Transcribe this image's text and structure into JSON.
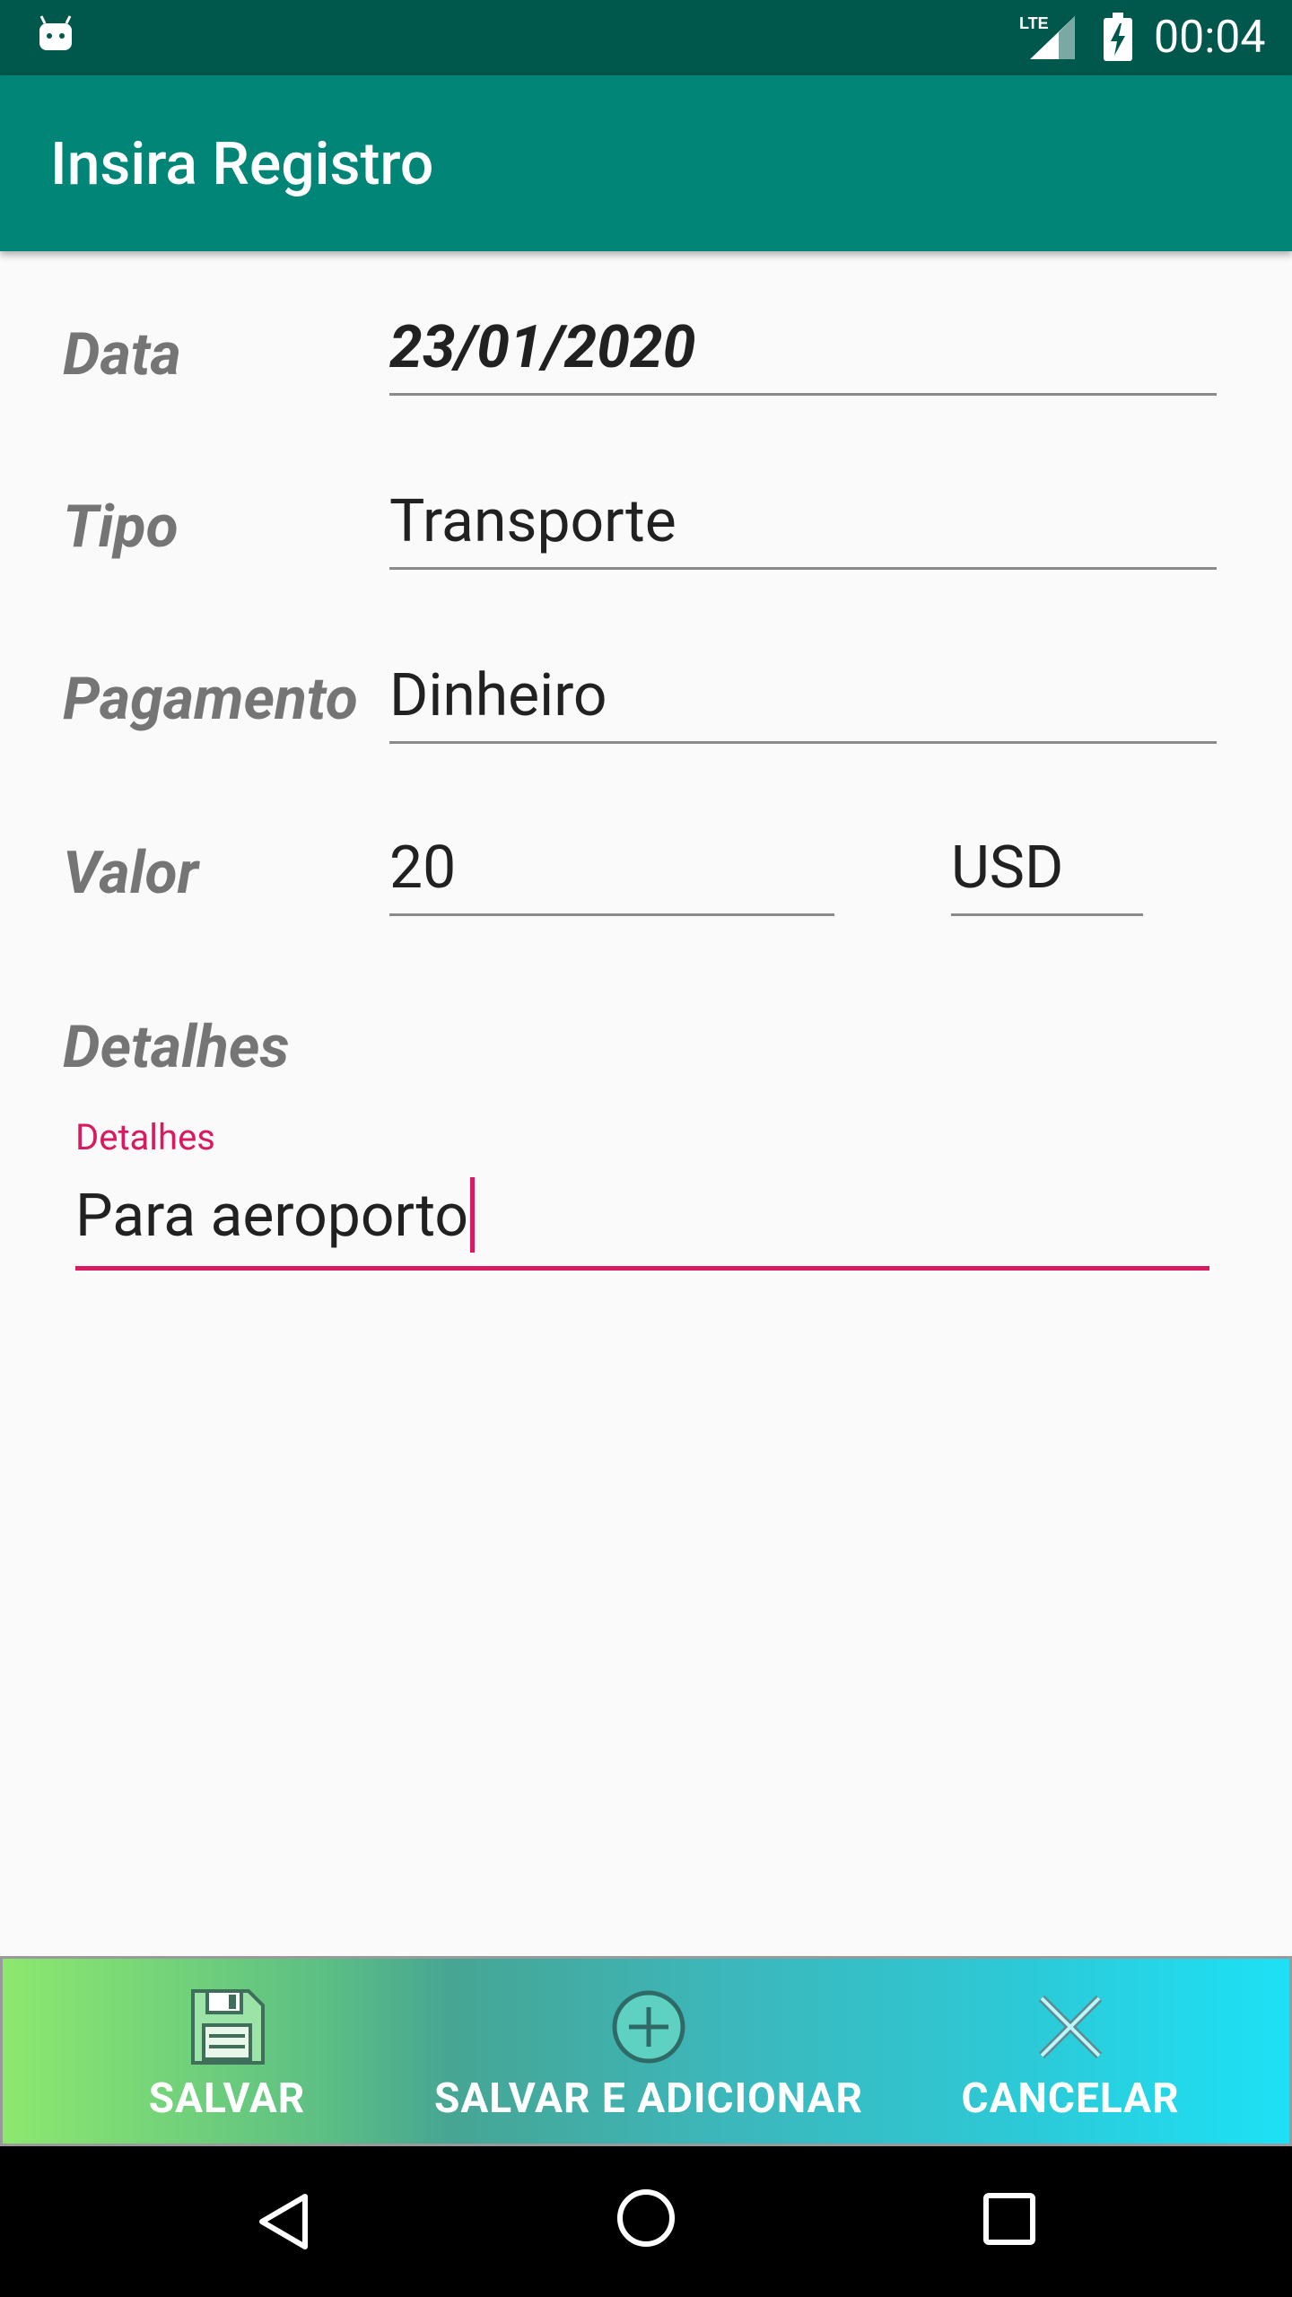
{
  "status_bar": {
    "time": "00:04",
    "network": "LTE"
  },
  "app_bar": {
    "title": "Insira Registro"
  },
  "form": {
    "date_label": "Data",
    "date_value": "23/01/2020",
    "type_label": "Tipo",
    "type_value": "Transporte",
    "payment_label": "Pagamento",
    "payment_value": "Dinheiro",
    "amount_label": "Valor",
    "amount_value": "20",
    "currency_value": "USD",
    "details_label": "Detalhes",
    "details_hint": "Detalhes",
    "details_value": "Para aeroporto"
  },
  "actions": {
    "save": "SALVAR",
    "save_add": "SALVAR E ADICIONAR",
    "cancel": "CANCELAR"
  },
  "colors": {
    "status_bar": "#00574b",
    "app_bar": "#008577",
    "accent": "#d81b60"
  }
}
